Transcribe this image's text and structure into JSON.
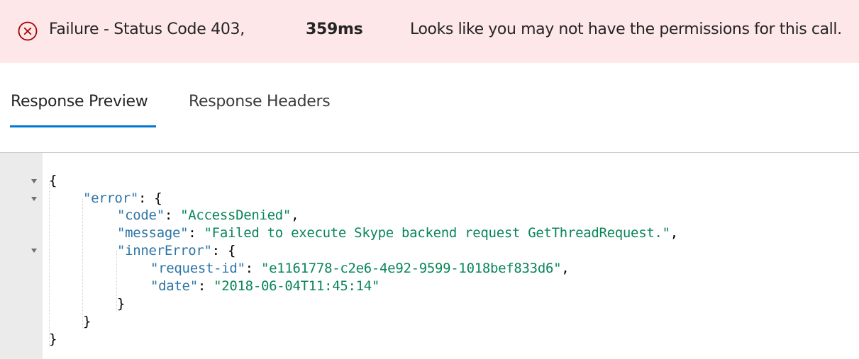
{
  "banner": {
    "status": "Failure - Status Code 403,",
    "duration": "359ms",
    "message": "Looks like you may not have the permissions for this call."
  },
  "tabs": [
    {
      "label": "Response Preview",
      "active": true
    },
    {
      "label": "Response Headers",
      "active": false
    }
  ],
  "response": {
    "open_brace": "{",
    "close_brace": "}",
    "error_key": "\"error\"",
    "code_key": "\"code\"",
    "code_value": "\"AccessDenied\"",
    "message_key": "\"message\"",
    "message_value": "\"Failed to execute Skype backend request GetThreadRequest.\"",
    "inner_key": "\"innerError\"",
    "request_id_key": "\"request-id\"",
    "request_id_value": "\"e1161778-c2e6-4e92-9599-1018bef833d6\"",
    "date_key": "\"date\"",
    "date_value": "\"2018-06-04T11:45:14\""
  },
  "colors": {
    "banner_bg": "#fde7e9",
    "error_red": "#a80000",
    "tab_accent": "#0078d4",
    "json_key": "#2e75a6",
    "json_string": "#098658"
  },
  "icons": [
    "error-circle-icon",
    "fold-arrow-icon"
  ]
}
